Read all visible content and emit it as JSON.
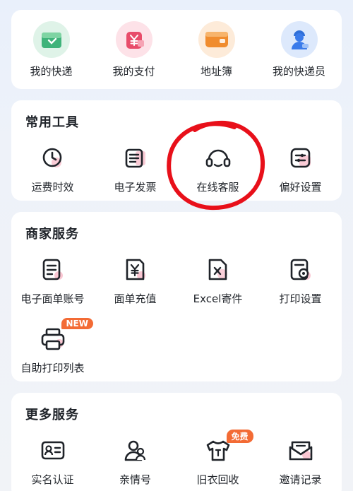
{
  "top_items": [
    {
      "label": "我的快递",
      "icon": "package-icon",
      "color": "#3fb37a"
    },
    {
      "label": "我的支付",
      "icon": "wallet-yuan-icon",
      "color": "#e84c6a"
    },
    {
      "label": "地址簿",
      "icon": "address-book-icon",
      "color": "#f08c2e"
    },
    {
      "label": "我的快递员",
      "icon": "courier-icon",
      "color": "#3a7bea"
    }
  ],
  "tools": {
    "title": "常用工具",
    "items": [
      {
        "label": "运费时效",
        "icon": "clock-icon"
      },
      {
        "label": "电子发票",
        "icon": "invoice-icon"
      },
      {
        "label": "在线客服",
        "icon": "headset-icon"
      },
      {
        "label": "偏好设置",
        "icon": "sliders-icon"
      }
    ]
  },
  "merchant": {
    "title": "商家服务",
    "items": [
      {
        "label": "电子面单账号",
        "icon": "waybill-account-icon"
      },
      {
        "label": "面单充值",
        "icon": "recharge-icon"
      },
      {
        "label": "Excel寄件",
        "icon": "excel-file-icon"
      },
      {
        "label": "打印设置",
        "icon": "print-settings-icon"
      },
      {
        "label": "自助打印列表",
        "icon": "printer-icon",
        "badge": "NEW"
      }
    ]
  },
  "more": {
    "title": "更多服务",
    "items": [
      {
        "label": "实名认证",
        "icon": "id-card-icon"
      },
      {
        "label": "亲情号",
        "icon": "family-icon"
      },
      {
        "label": "旧衣回收",
        "icon": "tshirt-icon",
        "badge": "免费"
      },
      {
        "label": "邀请记录",
        "icon": "invite-mail-icon"
      }
    ]
  },
  "colors": {
    "icon_stroke": "#1f2329",
    "icon_accent": "#f5a0b4",
    "badge": "#f36b35",
    "annotation_circle": "#e8101a"
  }
}
